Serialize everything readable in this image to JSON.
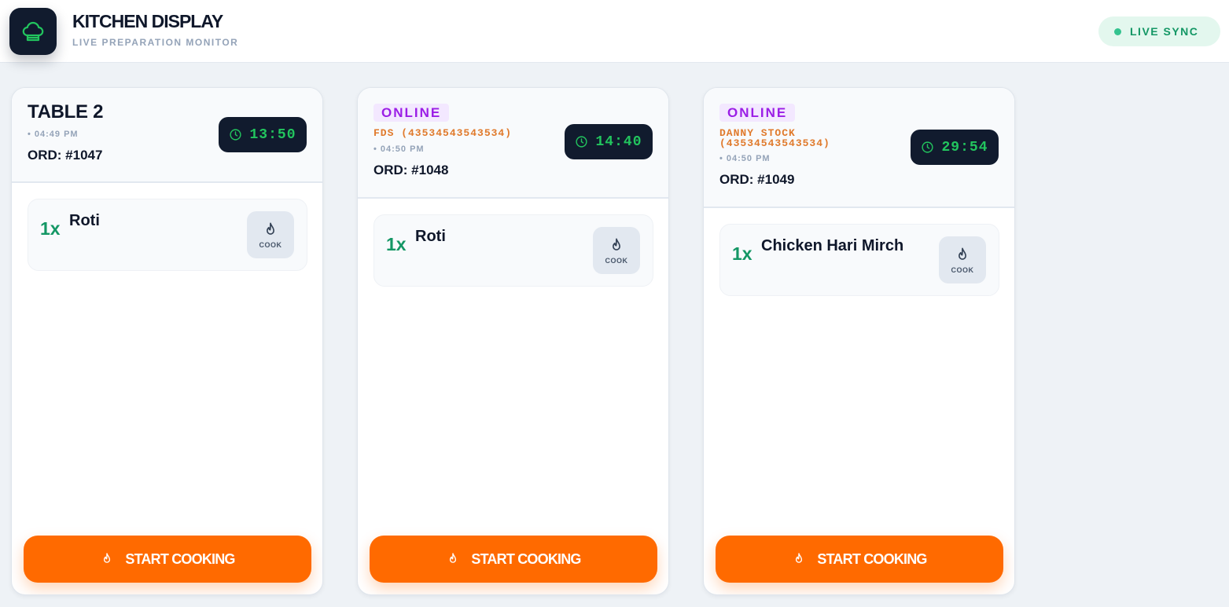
{
  "header": {
    "logo_icon": "chef-hat-icon",
    "title": "KITCHEN DISPLAY",
    "subtitle": "LIVE PREPARATION MONITOR",
    "sync_label": "LIVE SYNC"
  },
  "colors": {
    "accent_orange": "#ff6a00",
    "timer_green": "#22c55e",
    "qty_green": "#149765",
    "online_purple": "#9b1ee6",
    "dark_navy": "#111b2e"
  },
  "orders": [
    {
      "table": "TABLE 2",
      "time": "• 04:49 PM",
      "order_id": "ORD: #1047",
      "timer": "13:50",
      "items": [
        {
          "qty": "1x",
          "name": "Roti",
          "action": "COOK",
          "icon": "flame-icon"
        }
      ],
      "action_label": "START COOKING"
    },
    {
      "tag": "ONLINE",
      "customer": "FDS (43534543543534)",
      "time": "• 04:50 PM",
      "order_id": "ORD: #1048",
      "timer": "14:40",
      "items": [
        {
          "qty": "1x",
          "name": "Roti",
          "action": "COOK",
          "icon": "flame-icon"
        }
      ],
      "action_label": "START COOKING"
    },
    {
      "tag": "ONLINE",
      "customer_line1": "DANNY STOCK",
      "customer_line2": "(43534543543534)",
      "time": "• 04:50 PM",
      "order_id": "ORD: #1049",
      "timer": "29:54",
      "items": [
        {
          "qty": "1x",
          "name": "Chicken Hari Mirch",
          "action": "COOK",
          "icon": "flame-icon"
        }
      ],
      "action_label": "START COOKING"
    }
  ]
}
